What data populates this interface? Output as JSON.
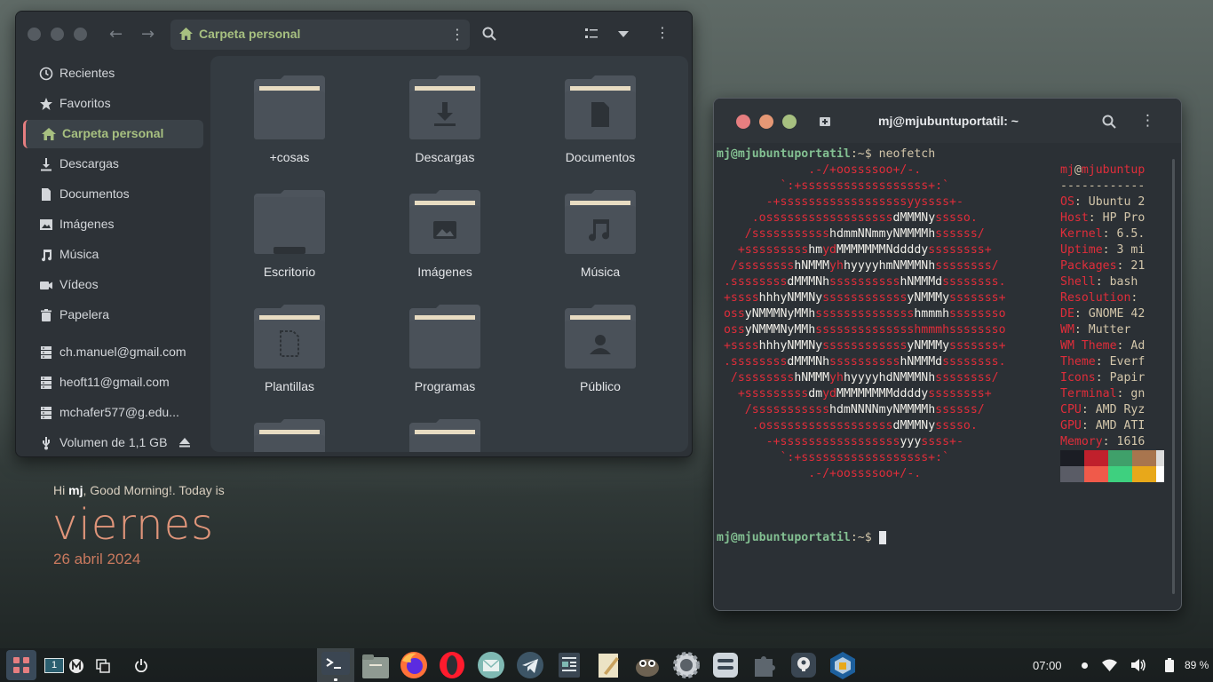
{
  "file_manager": {
    "path_label": "Carpeta personal",
    "sidebar": [
      {
        "label": "Recientes",
        "icon": "clock-icon"
      },
      {
        "label": "Favoritos",
        "icon": "star-icon"
      },
      {
        "label": "Carpeta personal",
        "icon": "home-icon",
        "selected": true
      },
      {
        "label": "Descargas",
        "icon": "download-icon"
      },
      {
        "label": "Documentos",
        "icon": "document-icon"
      },
      {
        "label": "Imágenes",
        "icon": "image-icon"
      },
      {
        "label": "Música",
        "icon": "music-icon"
      },
      {
        "label": "Vídeos",
        "icon": "video-icon"
      },
      {
        "label": "Papelera",
        "icon": "trash-icon"
      },
      {
        "label": "ch.manuel@gmail.com",
        "icon": "network-drive-icon"
      },
      {
        "label": "heoft11@gmail.com",
        "icon": "network-drive-icon"
      },
      {
        "label": "mchafer577@g.edu...",
        "icon": "network-drive-icon"
      },
      {
        "label": "Volumen de 1,1 GB",
        "icon": "usb-icon"
      }
    ],
    "folders": [
      {
        "label": "+cosas",
        "emblem": "none"
      },
      {
        "label": "Descargas",
        "emblem": "download"
      },
      {
        "label": "Documentos",
        "emblem": "document"
      },
      {
        "label": "Escritorio",
        "emblem": "desktop"
      },
      {
        "label": "Imágenes",
        "emblem": "image"
      },
      {
        "label": "Música",
        "emblem": "music"
      },
      {
        "label": "Plantillas",
        "emblem": "template"
      },
      {
        "label": "Programas",
        "emblem": "none"
      },
      {
        "label": "Público",
        "emblem": "user"
      },
      {
        "label": "",
        "emblem": "none"
      },
      {
        "label": "",
        "emblem": "none"
      }
    ]
  },
  "terminal": {
    "title": "mj@mjubuntuportatil: ~",
    "prompt_user": "mj@mjubuntuportatil",
    "prompt_tail": ":~$ ",
    "command": "neofetch",
    "logo": [
      [
        [
          "r",
          "             .-/+oossssoo+/-."
        ]
      ],
      [
        [
          "r",
          "         `:+ssssssssssssssssss+:`"
        ]
      ],
      [
        [
          "r",
          "       -+ssssssssssssssssssyyssss+-"
        ]
      ],
      [
        [
          "r",
          "     .ossssssssssssssssss"
        ],
        [
          "w",
          "dMMMNy"
        ],
        [
          "r",
          "sssso."
        ]
      ],
      [
        [
          "r",
          "    /sssssssssss"
        ],
        [
          "w",
          "hdmmNNmmyNMMMMh"
        ],
        [
          "r",
          "ssssss/"
        ]
      ],
      [
        [
          "r",
          "   +sssssssss"
        ],
        [
          "w",
          "hm"
        ],
        [
          "r",
          "yd"
        ],
        [
          "w",
          "MMMMMMMNddddy"
        ],
        [
          "r",
          "ssssssss+"
        ]
      ],
      [
        [
          "r",
          "  /ssssssss"
        ],
        [
          "w",
          "hNMMM"
        ],
        [
          "r",
          "yh"
        ],
        [
          "w",
          "hyyyyhmNMMMNh"
        ],
        [
          "r",
          "ssssssss/"
        ]
      ],
      [
        [
          "r",
          " .ssssssss"
        ],
        [
          "w",
          "dMMMNh"
        ],
        [
          "r",
          "ssssssssss"
        ],
        [
          "w",
          "hNMMMd"
        ],
        [
          "r",
          "ssssssss."
        ]
      ],
      [
        [
          "r",
          " +ssss"
        ],
        [
          "w",
          "hhhyNMMNy"
        ],
        [
          "r",
          "ssssssssssss"
        ],
        [
          "w",
          "yNMMMy"
        ],
        [
          "r",
          "sssssss+"
        ]
      ],
      [
        [
          "r",
          " oss"
        ],
        [
          "w",
          "yNMMMNyMMh"
        ],
        [
          "r",
          "ssssssssssssss"
        ],
        [
          "w",
          "hmmmh"
        ],
        [
          "r",
          "ssssssso"
        ]
      ],
      [
        [
          "r",
          " oss"
        ],
        [
          "w",
          "yNMMMNyMMh"
        ],
        [
          "r",
          "sssssssssssssshmmmhssssssso"
        ]
      ],
      [
        [
          "r",
          " +ssss"
        ],
        [
          "w",
          "hhhyNMMNy"
        ],
        [
          "r",
          "ssssssssssss"
        ],
        [
          "w",
          "yNMMMy"
        ],
        [
          "r",
          "sssssss+"
        ]
      ],
      [
        [
          "r",
          " .ssssssss"
        ],
        [
          "w",
          "dMMMNh"
        ],
        [
          "r",
          "ssssssssss"
        ],
        [
          "w",
          "hNMMMd"
        ],
        [
          "r",
          "ssssssss."
        ]
      ],
      [
        [
          "r",
          "  /ssssssss"
        ],
        [
          "w",
          "hNMMM"
        ],
        [
          "r",
          "yh"
        ],
        [
          "w",
          "hyyyyhdNMMMNh"
        ],
        [
          "r",
          "ssssssss/"
        ]
      ],
      [
        [
          "r",
          "   +sssssssss"
        ],
        [
          "w",
          "dm"
        ],
        [
          "r",
          "yd"
        ],
        [
          "w",
          "MMMMMMMMddddy"
        ],
        [
          "r",
          "ssssssss+"
        ]
      ],
      [
        [
          "r",
          "    /sssssssssss"
        ],
        [
          "w",
          "hdmNNNNmyNMMMMh"
        ],
        [
          "r",
          "ssssss/"
        ]
      ],
      [
        [
          "r",
          "     .ossssssssssssssssss"
        ],
        [
          "w",
          "dMMMNy"
        ],
        [
          "r",
          "sssso."
        ]
      ],
      [
        [
          "r",
          "       -+sssssssssssssssss"
        ],
        [
          "w",
          "yyy"
        ],
        [
          "r",
          "ssss+-"
        ]
      ],
      [
        [
          "r",
          "         `:+ssssssssssssssssss+:`"
        ]
      ],
      [
        [
          "r",
          "             .-/+oossssoo+/-."
        ]
      ]
    ],
    "info_header_user": "mj",
    "info_header_host": "mjubuntup",
    "info_separator": "------------",
    "info": [
      {
        "k": "OS",
        "v": " Ubuntu 2"
      },
      {
        "k": "Host",
        "v": " HP Pro"
      },
      {
        "k": "Kernel",
        "v": " 6.5."
      },
      {
        "k": "Uptime",
        "v": " 3 mi"
      },
      {
        "k": "Packages",
        "v": " 21"
      },
      {
        "k": "Shell",
        "v": " bash"
      },
      {
        "k": "Resolution",
        "v": ""
      },
      {
        "k": "DE",
        "v": " GNOME 42"
      },
      {
        "k": "WM",
        "v": " Mutter"
      },
      {
        "k": "WM Theme",
        "v": " Ad"
      },
      {
        "k": "Theme",
        "v": " Everf"
      },
      {
        "k": "Icons",
        "v": " Papir"
      },
      {
        "k": "Terminal",
        "v": " gn"
      },
      {
        "k": "CPU",
        "v": " AMD Ryz"
      },
      {
        "k": "GPU",
        "v": " AMD ATI"
      },
      {
        "k": "Memory",
        "v": " 1616"
      }
    ],
    "palette_top": [
      "#1b1d24",
      "#c0202c",
      "#3fa06a",
      "#a8754e",
      "#dcdcdc"
    ],
    "palette_bottom": [
      "#5a5c66",
      "#f05a4a",
      "#3ed07f",
      "#e8a81a",
      "#ffffff"
    ]
  },
  "widget": {
    "greet_pre": "Hi ",
    "greet_name": "mj",
    "greet_post": ", Good Morning!. Today is",
    "day": "viernes",
    "date": "26 abril 2024"
  },
  "taskbar": {
    "workspace": "1",
    "time": "07:00",
    "battery": "89 %",
    "apps": [
      "terminal-icon",
      "files-icon",
      "firefox-icon",
      "opera-icon",
      "mail-icon",
      "telegram-icon",
      "news-icon",
      "notes-icon",
      "gimp-icon",
      "settings-icon",
      "software-icon",
      "extensions-icon",
      "keyring-icon",
      "virtualbox-icon"
    ]
  },
  "colors": {
    "accent_green": "#a7c080",
    "accent_red": "#e02d3a",
    "day_color": "#e0957a"
  }
}
